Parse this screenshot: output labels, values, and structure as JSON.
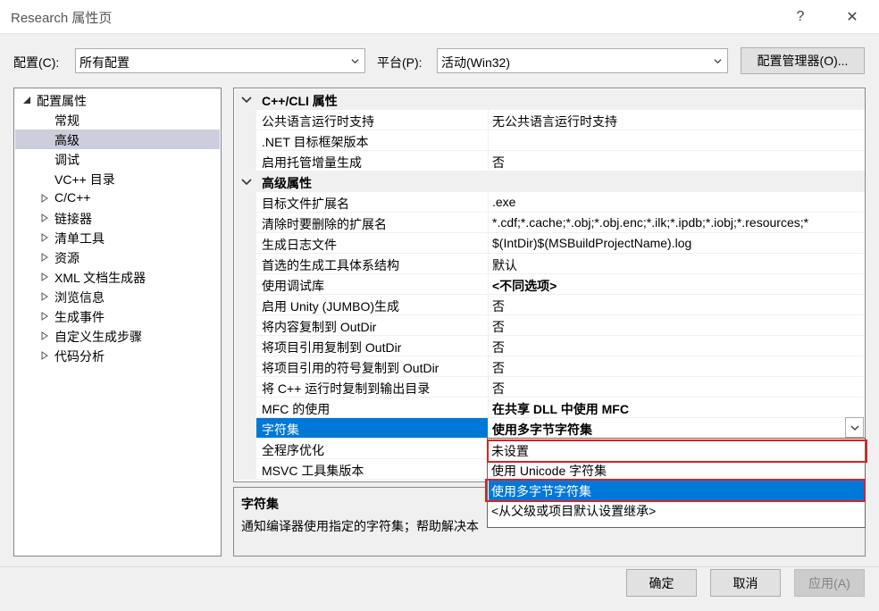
{
  "window": {
    "title": "Research 属性页",
    "help_glyph": "?",
    "close_glyph": "✕"
  },
  "config_bar": {
    "config_label": "配置(C):",
    "config_value": "所有配置",
    "platform_label": "平台(P):",
    "platform_value": "活动(Win32)",
    "manager_button": "配置管理器(O)..."
  },
  "tree": {
    "items": [
      {
        "label": "配置属性",
        "expanded": true
      },
      {
        "label": "常规"
      },
      {
        "label": "高级",
        "selected": true
      },
      {
        "label": "调试"
      },
      {
        "label": "VC++ 目录"
      },
      {
        "label": "C/C++"
      },
      {
        "label": "链接器"
      },
      {
        "label": "清单工具"
      },
      {
        "label": "资源"
      },
      {
        "label": "XML 文档生成器"
      },
      {
        "label": "浏览信息"
      },
      {
        "label": "生成事件"
      },
      {
        "label": "自定义生成步骤"
      },
      {
        "label": "代码分析"
      }
    ]
  },
  "grid": {
    "cat1": "C++/CLI 属性",
    "cat2": "高级属性",
    "rows": [
      {
        "name": "公共语言运行时支持",
        "value": "无公共语言运行时支持"
      },
      {
        "name": ".NET 目标框架版本",
        "value": ""
      },
      {
        "name": "启用托管增量生成",
        "value": "否"
      },
      {
        "name": "目标文件扩展名",
        "value": ".exe"
      },
      {
        "name": "清除时要删除的扩展名",
        "value": "*.cdf;*.cache;*.obj;*.obj.enc;*.ilk;*.ipdb;*.iobj;*.resources;*"
      },
      {
        "name": "生成日志文件",
        "value": "$(IntDir)$(MSBuildProjectName).log"
      },
      {
        "name": "首选的生成工具体系结构",
        "value": "默认"
      },
      {
        "name": "使用调试库",
        "value": "<不同选项>"
      },
      {
        "name": "启用 Unity (JUMBO)生成",
        "value": "否"
      },
      {
        "name": "将内容复制到 OutDir",
        "value": "否"
      },
      {
        "name": "将项目引用复制到 OutDir",
        "value": "否"
      },
      {
        "name": "将项目引用的符号复制到 OutDir",
        "value": "否"
      },
      {
        "name": "将 C++ 运行时复制到输出目录",
        "value": "否"
      },
      {
        "name": "MFC 的使用",
        "value": "在共享 DLL 中使用 MFC"
      },
      {
        "name": "字符集",
        "value": "使用多字节字符集"
      },
      {
        "name": "全程序优化",
        "value": ""
      },
      {
        "name": "MSVC 工具集版本",
        "value": ""
      }
    ]
  },
  "dropdown": {
    "options": [
      "未设置",
      "使用 Unicode 字符集",
      "使用多字节字符集",
      "<从父级或项目默认设置继承>"
    ]
  },
  "description": {
    "title": "字符集",
    "text": "通知编译器使用指定的字符集；帮助解决本"
  },
  "buttons": {
    "ok": "确定",
    "cancel": "取消",
    "apply": "应用(A)"
  },
  "colors": {
    "selection": "#0078d7",
    "tree_selection": "#cccedb",
    "highlight_box": "#e02020"
  }
}
